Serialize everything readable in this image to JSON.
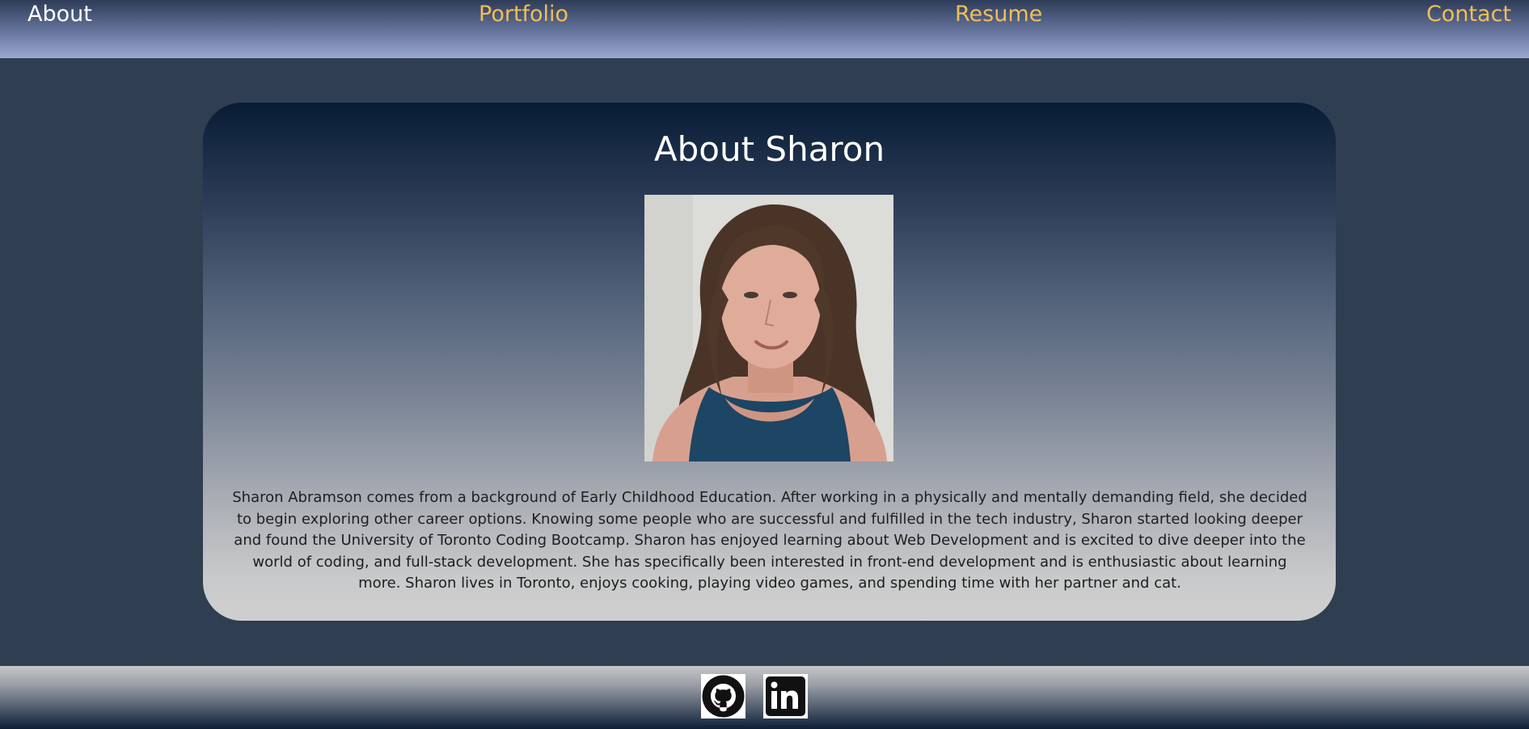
{
  "nav": {
    "items": [
      {
        "label": "About",
        "active": true
      },
      {
        "label": "Portfolio",
        "active": false
      },
      {
        "label": "Resume",
        "active": false
      },
      {
        "label": "Contact",
        "active": false
      }
    ]
  },
  "about": {
    "title": "About Sharon",
    "photo_icon": "profile-photo",
    "bio": "Sharon Abramson comes from a background of Early Childhood Education. After working in a physically and mentally demanding field, she decided to begin exploring other career options. Knowing some people who are successful and fulfilled in the tech industry, Sharon started looking deeper and found the University of Toronto Coding Bootcamp. Sharon has enjoyed learning about Web Development and is excited to dive deeper into the world of coding, and full-stack development. She has specifically been interested in front-end development and is enthusiastic about learning more. Sharon lives in Toronto, enjoys cooking, playing video games, and spending time with her partner and cat."
  },
  "footer": {
    "links": [
      {
        "icon": "github-icon"
      },
      {
        "icon": "linkedin-icon"
      }
    ]
  },
  "colors": {
    "page_bg": "#2f3e51",
    "nav_link": "#f0be5a",
    "nav_active": "#ffffff"
  }
}
